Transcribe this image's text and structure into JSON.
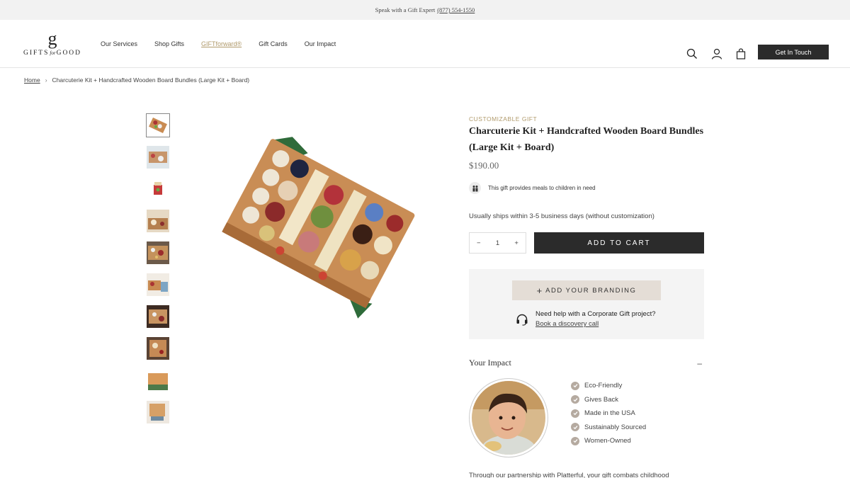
{
  "topbar": {
    "text": "Speak with a Gift Expert",
    "phone": "(877) 554-1550"
  },
  "logo": {
    "letter": "g",
    "left": "GIFTS",
    "middle": "for",
    "right": "GOOD"
  },
  "nav": [
    {
      "label": "Our Services"
    },
    {
      "label": "Shop Gifts"
    },
    {
      "label": "GIFTforward®"
    },
    {
      "label": "Gift Cards"
    },
    {
      "label": "Our Impact"
    }
  ],
  "header": {
    "icons": [
      "search-icon",
      "account-icon",
      "shopping-bag-icon"
    ],
    "cta_label": "Get In Touch"
  },
  "breadcrumb": {
    "home": "Home",
    "separator": "›",
    "current": "Charcuterie Kit + Handcrafted Wooden Board Bundles (Large Kit + Board)"
  },
  "gallery": {
    "thumbnail_count": 10,
    "active_index": 0
  },
  "product": {
    "eyebrow": "CUSTOMIZABLE GIFT",
    "title_line1": "Charcuterie Kit + Handcrafted Wooden Board Bundles",
    "title_line2": "(Large Kit + Board)",
    "price": "$190.00",
    "meals_text": "This gift provides meals to children in need",
    "shipping": "Usually ships within 3-5 business days (without customization)",
    "quantity": "1",
    "qty_minus": "−",
    "qty_plus": "+",
    "add_to_cart": "ADD TO CART"
  },
  "branding": {
    "button_icon": "+",
    "button_label": "ADD YOUR BRANDING",
    "help_text": "Need help with a Corporate Gift project?",
    "help_link": "Book a discovery call"
  },
  "impact": {
    "title": "Your Impact",
    "toggle": "–",
    "features": [
      "Eco-Friendly",
      "Gives Back",
      "Made in the USA",
      "Sustainably Sourced",
      "Women-Owned"
    ],
    "partner_text": "Through our partnership with Platterful, your gift combats childhood"
  },
  "colors": {
    "accent": "#b09a6b",
    "dark_button": "#2b2b2b",
    "branding_button": "#e4ddd6",
    "panel": "#f4f4f4"
  }
}
